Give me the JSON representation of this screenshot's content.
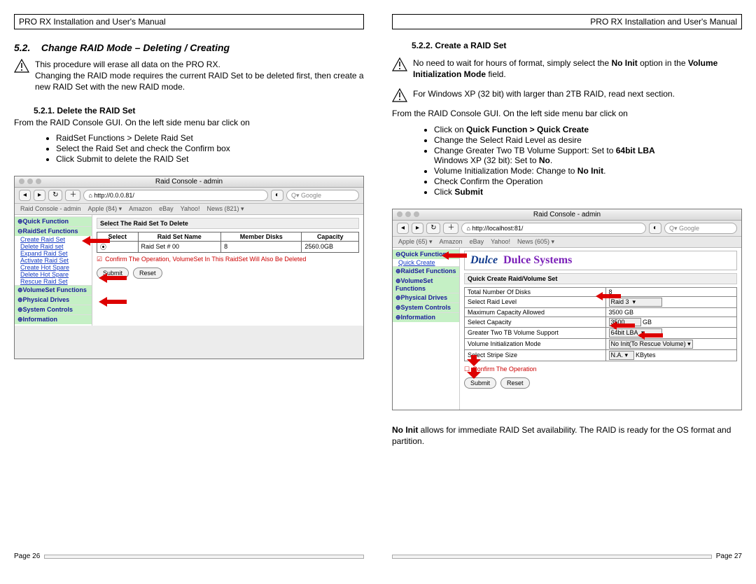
{
  "doc_title": "PRO RX Installation and User's Manual",
  "left": {
    "section_no": "5.2.",
    "section_title": "Change RAID Mode – Deleting / Creating",
    "intro1": "This procedure will erase all data on the PRO RX.",
    "intro2": "Changing the RAID mode requires the current RAID Set to be deleted first, then create a new RAID Set with the new RAID mode.",
    "sub_no": "5.2.1.",
    "sub_title": "Delete the RAID Set",
    "lead": "From the RAID Console GUI.  On the left side menu bar click on",
    "bullets": [
      "RaidSet Functions > Delete Raid Set",
      "Select the Raid Set and check the Confirm box",
      "Click Submit to delete the RAID Set"
    ],
    "shot": {
      "title": "Raid Console - admin",
      "addr": "http://0.0.0.81/",
      "search": "Google",
      "bookmarks": [
        "Raid Console - admin",
        "Apple (84) ▾",
        "Amazon",
        "eBay",
        "Yahoo!",
        "News (821) ▾"
      ],
      "sidebar": {
        "groups": [
          {
            "head": "⊕Quick Function",
            "items": []
          },
          {
            "head": "⊖RaidSet Functions",
            "items": [
              "Create Raid Set",
              "Delete Raid set",
              "Expand Raid Set",
              "Activate Raid Set",
              "Create Hot Spare",
              "Delete Hot Spare",
              "Rescue Raid Set"
            ]
          },
          {
            "head": "⊕VolumeSet Functions",
            "items": []
          },
          {
            "head": "⊕Physical Drives",
            "items": []
          },
          {
            "head": "⊕System Controls",
            "items": []
          },
          {
            "head": "⊕Information",
            "items": []
          }
        ]
      },
      "panel_title": "Select The Raid Set To Delete",
      "table": {
        "headers": [
          "Select",
          "Raid Set Name",
          "Member Disks",
          "Capacity"
        ],
        "row": [
          "⦿",
          "Raid Set # 00",
          "8",
          "2560.0GB"
        ]
      },
      "confirm": "Confirm The Operation, VolumeSet In This RaidSet Will Also Be Deleted",
      "submit": "Submit",
      "reset": "Reset"
    },
    "page_no": "Page 26"
  },
  "right": {
    "sub_no": "5.2.2.",
    "sub_title": "Create a RAID Set",
    "warn1a": "No need to wait for hours of format, simply select the ",
    "warn1b": "No Init",
    "warn1c": " option in the ",
    "warn1d": "Volume Initialization Mode",
    "warn1e": " field.",
    "warn2": "For Windows XP (32 bit) with larger than 2TB RAID, read next section.",
    "lead": "From the RAID Console GUI.  On the left side menu bar click on",
    "bul1a": "Click on ",
    "bul1b": "Quick Function > Quick Create",
    "bul2": "Change the Select Raid Level as desire",
    "bul3a": "Change Greater Two TB Volume Support: Set to ",
    "bul3b": "64bit LBA",
    "bul3c": "Windows XP (32 bit): Set to ",
    "bul3d": "No",
    "bul4a": "Volume Initialization Mode: Change to ",
    "bul4b": "No Init",
    "bul5": "Check Confirm the Operation",
    "bul6a": "Click ",
    "bul6b": "Submit",
    "shot": {
      "title": "Raid Console - admin",
      "addr": "http://localhost:81/",
      "search": "Google",
      "bookmarks": [
        "Apple (65) ▾",
        "Amazon",
        "eBay",
        "Yahoo!",
        "News (605) ▾"
      ],
      "sidebar": {
        "groups": [
          {
            "head": "⊖Quick Function",
            "items": [
              "Quick Create"
            ]
          },
          {
            "head": "⊕RaidSet Functions",
            "items": []
          },
          {
            "head": "⊕VolumeSet Functions",
            "items": []
          },
          {
            "head": "⊕Physical Drives",
            "items": []
          },
          {
            "head": "⊕System Controls",
            "items": []
          },
          {
            "head": "⊕Information",
            "items": []
          }
        ]
      },
      "brand_logo": "Dulce",
      "brand_name": "Dulce Systems",
      "panel_title": "Quick Create Raid/Volume Set",
      "rows": [
        {
          "label": "Total Number Of Disks",
          "value": "8"
        },
        {
          "label": "Select Raid Level",
          "value": "Raid 3"
        },
        {
          "label": "Maximum Capacity Allowed",
          "value": "3500  GB"
        },
        {
          "label": "Select Capacity",
          "value": "3500",
          "unit": "GB"
        },
        {
          "label": "Greater Two TB Volume Support",
          "value": "64bit LBA"
        },
        {
          "label": "Volume Initialization Mode",
          "value": "No Init(To Rescue Volume)"
        },
        {
          "label": "Select Stripe Size",
          "value": "N.A.",
          "unit": "KBytes"
        }
      ],
      "confirm": "Confirm The Operation",
      "submit": "Submit",
      "reset": "Reset"
    },
    "note_a": "No Init",
    "note_b": " allows for immediate RAID Set availability.  The RAID is ready for the OS format and partition.",
    "page_no": "Page 27"
  }
}
